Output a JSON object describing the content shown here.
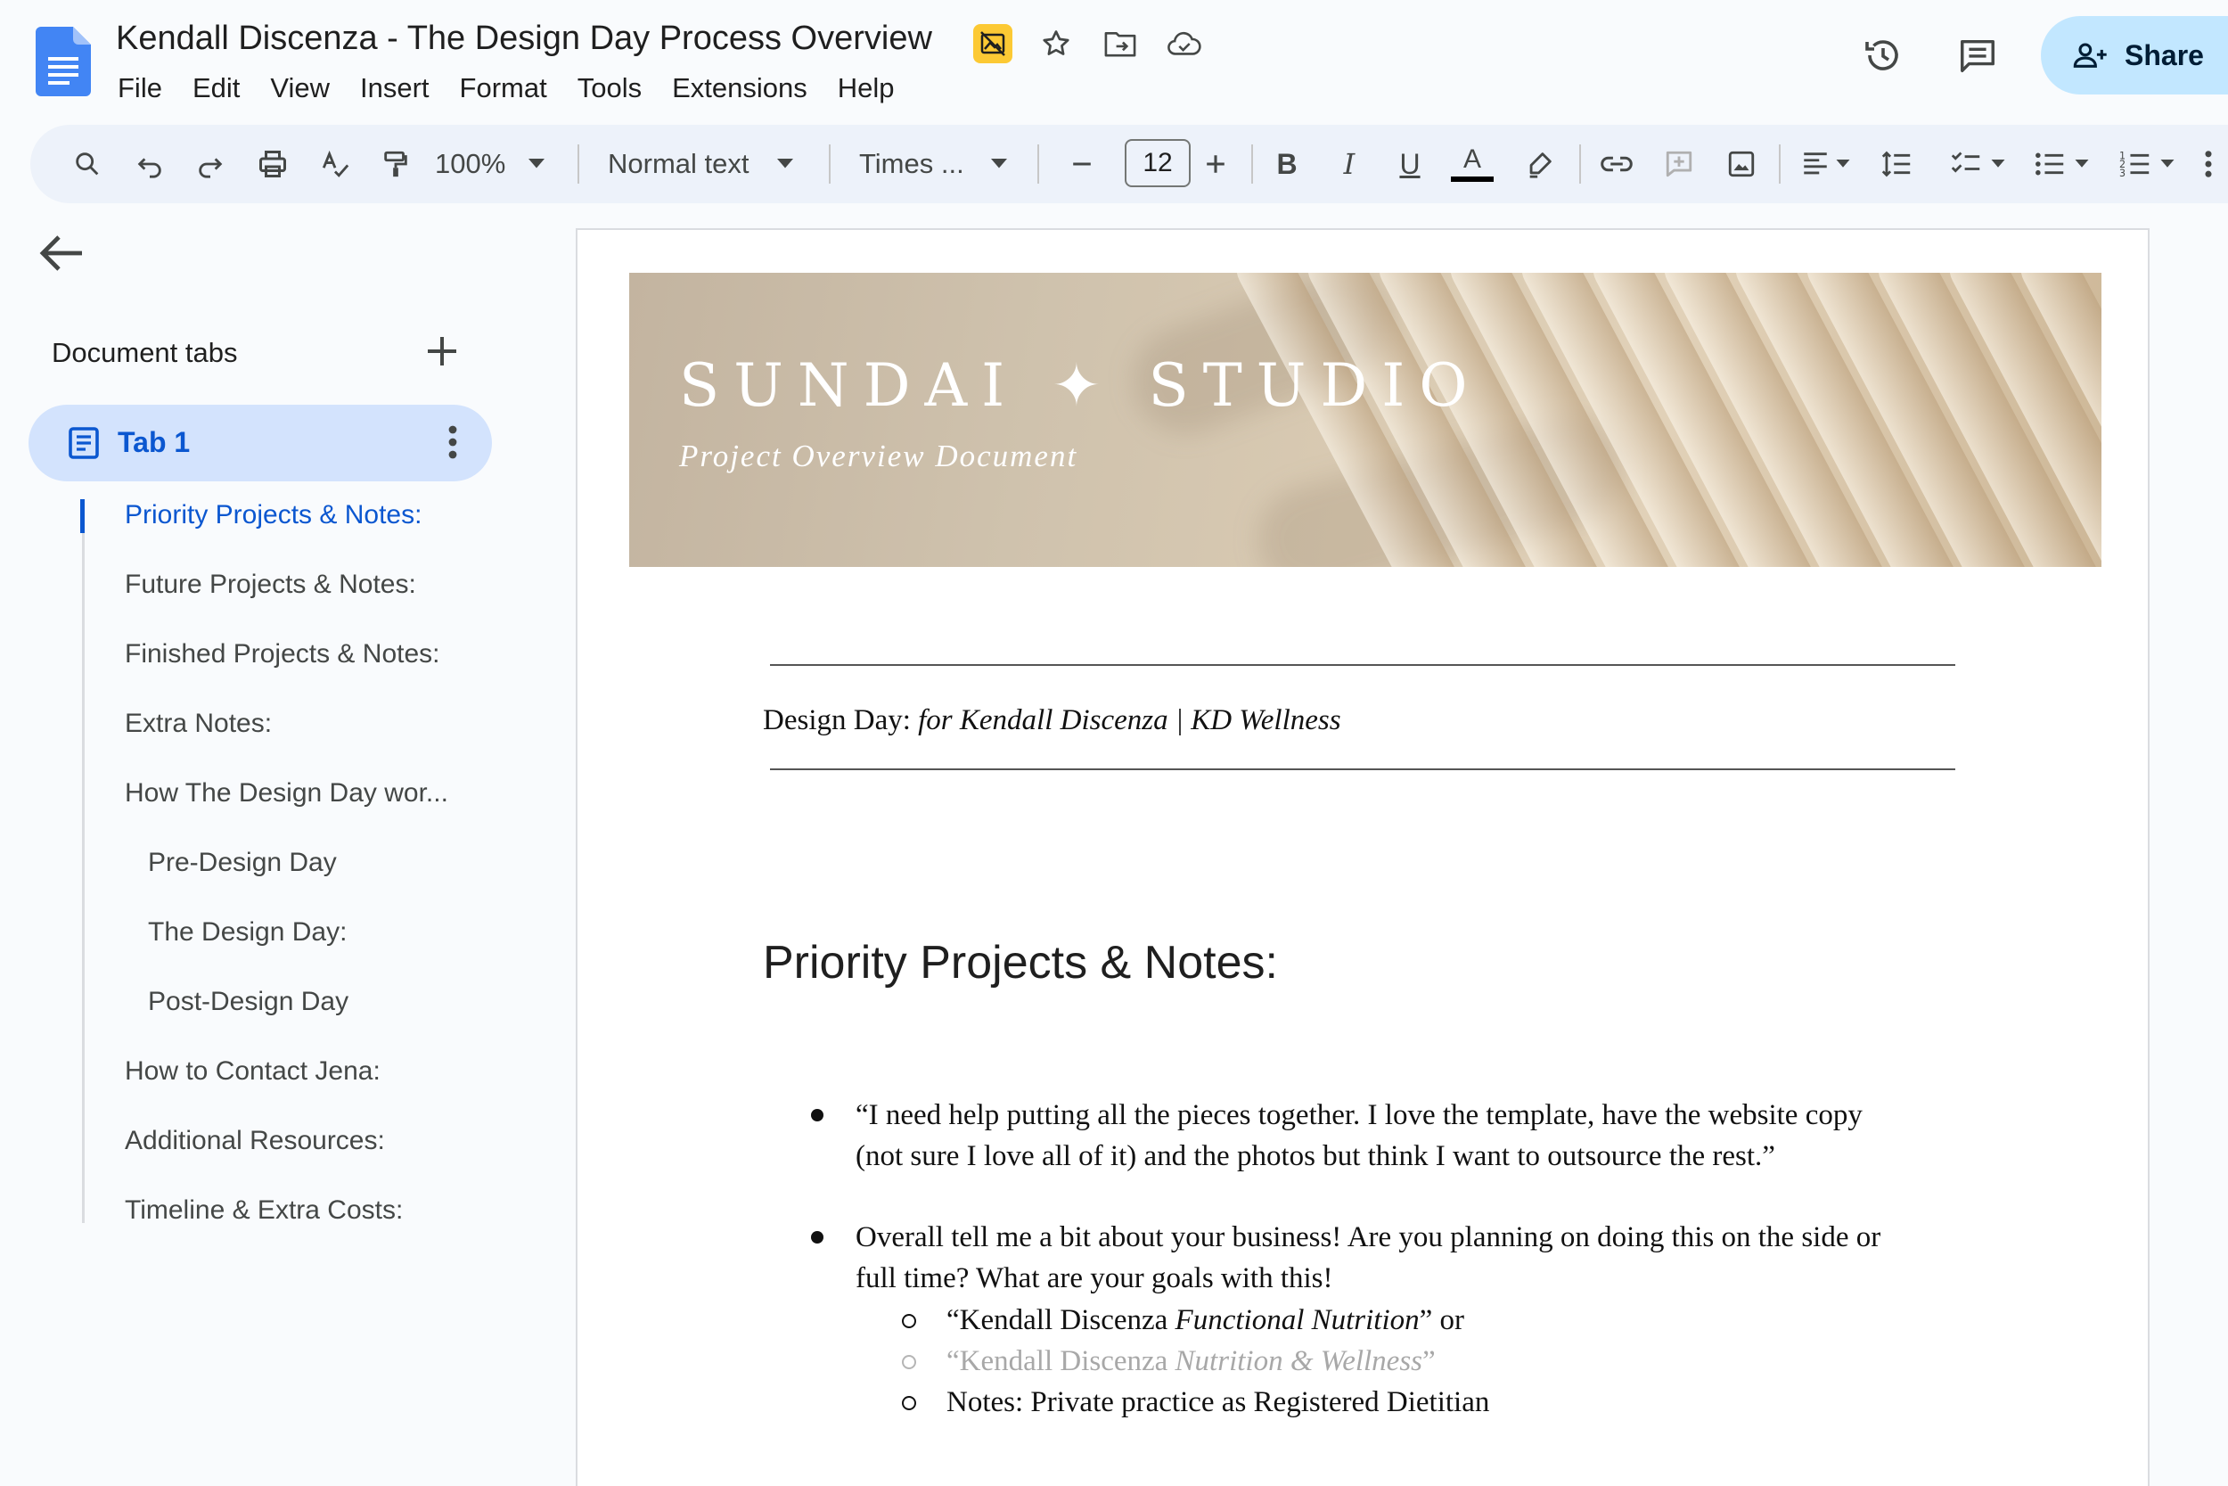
{
  "document": {
    "title": "Kendall Discenza - The Design Day Process Overview"
  },
  "menu": [
    "File",
    "Edit",
    "View",
    "Insert",
    "Format",
    "Tools",
    "Extensions",
    "Help"
  ],
  "header": {
    "share_label": "Share"
  },
  "toolbar": {
    "zoom": "100%",
    "style": "Normal text",
    "font": "Times ...",
    "font_size": "12"
  },
  "sidebar": {
    "heading": "Document tabs",
    "tab_label": "Tab 1",
    "outline": [
      {
        "label": "Priority Projects & Notes:",
        "level": 1,
        "active": true
      },
      {
        "label": "Future Projects & Notes:",
        "level": 1
      },
      {
        "label": "Finished Projects & Notes:",
        "level": 1
      },
      {
        "label": "Extra Notes:",
        "level": 1
      },
      {
        "label": "How The Design Day wor...",
        "level": 1
      },
      {
        "label": "Pre-Design Day",
        "level": 2
      },
      {
        "label": "The Design Day:",
        "level": 2
      },
      {
        "label": "Post-Design Day",
        "level": 2
      },
      {
        "label": "How to Contact Jena:",
        "level": 1
      },
      {
        "label": "Additional Resources:",
        "level": 1
      },
      {
        "label": "Timeline & Extra Costs:",
        "level": 1
      }
    ]
  },
  "page": {
    "banner_title": "SUNDAI ✦ STUDIO",
    "banner_subtitle": "Project Overview Document",
    "design_day_prefix": "Design Day: ",
    "design_day_detail": "for Kendall Discenza | KD Wellness",
    "heading": "Priority Projects & Notes:",
    "bullet1_line1": "“I need help putting all the pieces together. I love the template, have the website copy",
    "bullet1_line2": "(not sure I love all of it) and the photos but think I want to outsource the rest.”",
    "bullet2_line1": "Overall tell me a bit about your business! Are you planning on doing this on the side or",
    "bullet2_line2": "full time? What are your goals with this!",
    "sub1_pre": "“Kendall Discenza ",
    "sub1_em": "Functional Nutrition",
    "sub1_post": "” or",
    "sub2_pre": "“Kendall Discenza ",
    "sub2_em": "Nutrition & Wellness",
    "sub2_post": "”",
    "sub3": "Notes: Private practice as Registered Dietitian"
  },
  "colors": {
    "accent": "#0b57d0",
    "share_bg": "#c2e7ff",
    "toolbar_bg": "#edf2fa",
    "active_tab_bg": "#d3e3fd"
  }
}
